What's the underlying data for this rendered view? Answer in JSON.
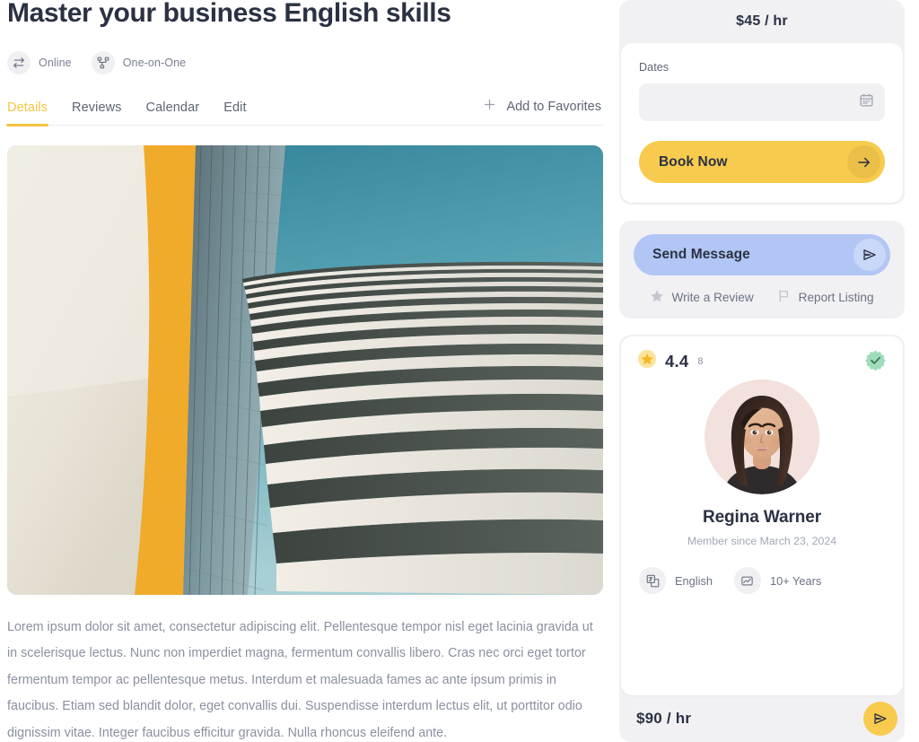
{
  "listing": {
    "title": "Master your business English skills",
    "tags": [
      {
        "label": "Online",
        "icon": "transfer-arrows-icon"
      },
      {
        "label": "One-on-One",
        "icon": "node-hierarchy-icon"
      }
    ],
    "tabs": [
      {
        "label": "Details",
        "active": true
      },
      {
        "label": "Reviews",
        "active": false
      },
      {
        "label": "Calendar",
        "active": false
      },
      {
        "label": "Edit",
        "active": false
      }
    ],
    "favorites": {
      "label": "Add to Favorites",
      "icon": "plus-icon"
    },
    "description": "Lorem ipsum dolor sit amet, consectetur adipiscing elit. Pellentesque tempor nisl eget lacinia gravida ut in scelerisque lectus. Nunc non imperdiet magna, fermentum convallis libero. Cras nec orci eget tortor fermentum tempor ac pellentesque metus. Interdum et malesuada fames ac ante ipsum primis in faucibus. Etiam sed blandit dolor, eget convallis dui. Suspendisse interdum lectus elit, ut porttitor odio dignissim vitae. Integer faucibus efficitur gravida. Nulla rhoncus eleifend ante.",
    "hero_image_alt": "modern-building-balconies-photo"
  },
  "booking": {
    "price": "$45 / hr",
    "dates_label": "Dates",
    "dates_value": "",
    "dates_placeholder": "",
    "calendar_icon": "calendar-icon",
    "cta_label": "Book Now",
    "cta_icon": "arrow-right-icon"
  },
  "message": {
    "send_label": "Send Message",
    "send_icon": "paper-plane-icon",
    "links": [
      {
        "label": "Write a Review",
        "icon": "star-icon"
      },
      {
        "label": "Report Listing",
        "icon": "flag-icon"
      }
    ]
  },
  "profile": {
    "rating_value": "4.4",
    "rating_count": "8",
    "rating_icon": "star-badge-icon",
    "verified_icon": "verified-check-icon",
    "avatar": "user-portrait-avatar",
    "name": "Regina Warner",
    "member_since": "Member since March 23, 2024",
    "meta": [
      {
        "label": "English",
        "icon": "translate-icon"
      },
      {
        "label": "10+ Years",
        "icon": "experience-flag-icon"
      }
    ],
    "footer_price": "$90 / hr",
    "footer_send_icon": "paper-plane-icon"
  },
  "colors": {
    "accent_yellow": "#f8cb4e",
    "message_blue": "#b2c6f5",
    "panel_grey": "#f1f1f3",
    "text_dark": "#2b3143",
    "text_muted": "#8b90a0",
    "verified_green": "#9fdcba"
  }
}
